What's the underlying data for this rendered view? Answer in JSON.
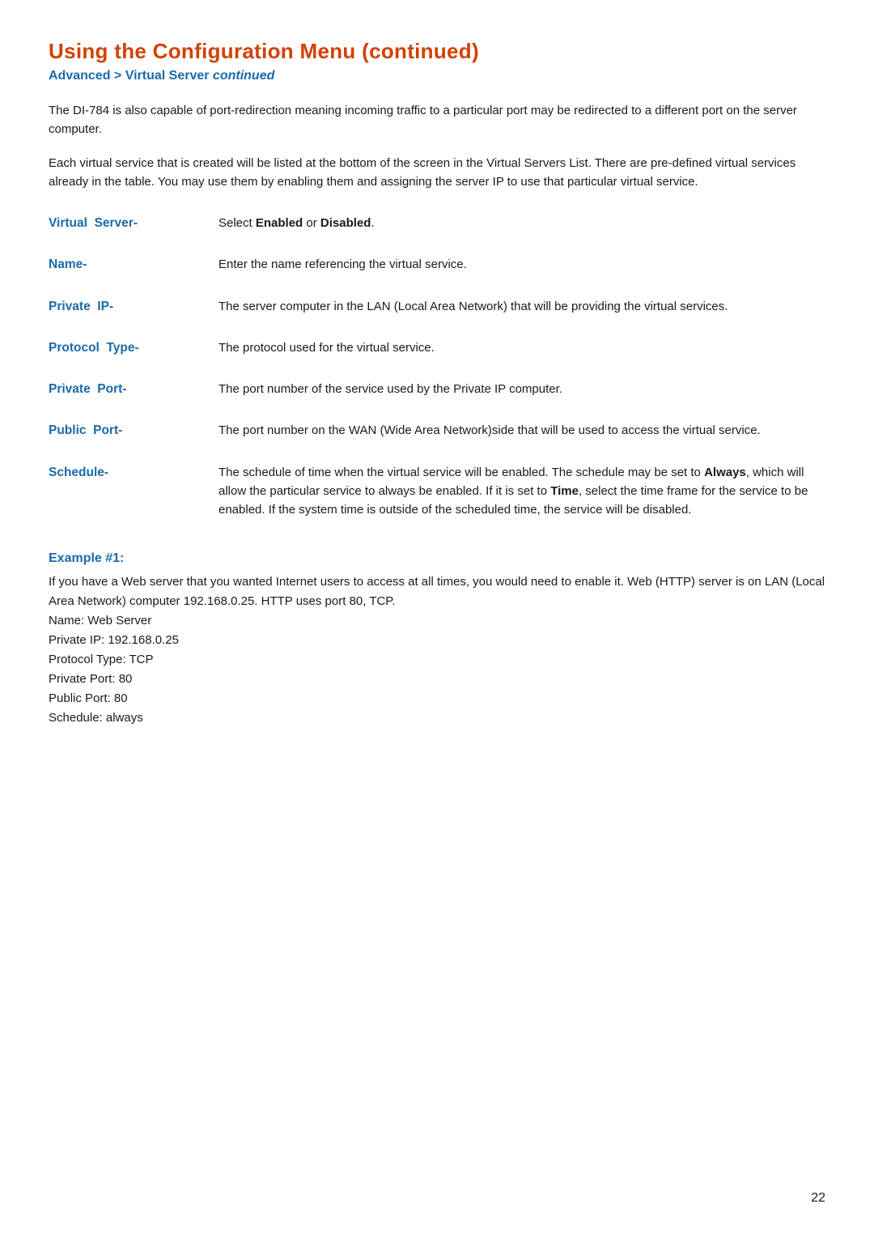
{
  "page": {
    "title": "Using the Configuration Menu (continued)",
    "breadcrumb": {
      "part1": "Advanced > Virtual Server ",
      "part2": "continued"
    },
    "intro1": "The DI-784 is also capable of port-redirection meaning incoming traffic to a particular port may be redirected to a different port on the server computer.",
    "intro2": "Each virtual service that is created will be listed at the bottom of the screen in the Virtual Servers List. There are pre-defined virtual services already in the table. You may use them by enabling them and assigning the server IP to use that particular virtual service.",
    "definitions": [
      {
        "term": "Virtual  Server-",
        "desc_plain": "Select ",
        "desc_bold1": "Enabled",
        "desc_middle": " or ",
        "desc_bold2": "Disabled",
        "desc_end": ".",
        "type": "bold"
      },
      {
        "term": "Name-",
        "desc": "Enter the name referencing the virtual service.",
        "type": "plain"
      },
      {
        "term": "Private  IP-",
        "desc": "The server computer in the LAN (Local Area Network) that will be providing the virtual services.",
        "type": "plain"
      },
      {
        "term": "Protocol  Type-",
        "desc": "The protocol used for the virtual service.",
        "type": "plain"
      },
      {
        "term": "Private  Port-",
        "desc": "The port number of the service used by the Private IP computer.",
        "type": "plain"
      },
      {
        "term": "Public  Port-",
        "desc": "The port number on the WAN (Wide Area Network)side that will be used to access the virtual service.",
        "type": "plain"
      },
      {
        "term": "Schedule-",
        "desc_plain1": "The schedule of time when the virtual service will be enabled. The schedule may be set to ",
        "desc_bold1": "Always",
        "desc_middle1": ", which will allow the particular service to always be enabled. If it is set to ",
        "desc_bold2": "Time",
        "desc_end": ", select the time frame for the service to be enabled. If the system time is outside of the scheduled time, the service will be disabled.",
        "type": "schedule"
      }
    ],
    "example": {
      "title": "Example #1:",
      "text": "If you have a Web server that you wanted Internet users to access at all times, you would need to enable it. Web (HTTP) server is on LAN (Local Area Network) computer 192.168.0.25. HTTP uses port 80, TCP.\nName: Web Server\nPrivate IP: 192.168.0.25\nProtocol Type: TCP\nPrivate Port: 80\nPublic Port: 80\nSchedule: always"
    },
    "page_number": "22"
  }
}
